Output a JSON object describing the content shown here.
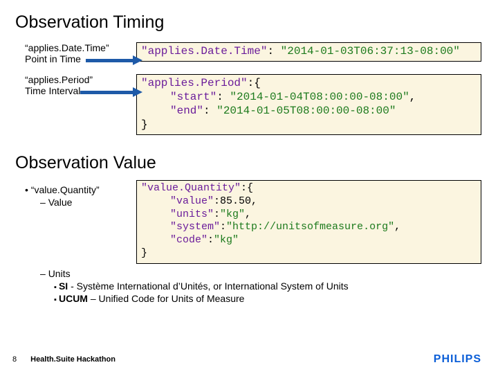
{
  "headings": {
    "timing": "Observation Timing",
    "value": "Observation Value"
  },
  "timing": {
    "datetime": {
      "label1": "“applies.Date.Time”",
      "label2": "Point in Time",
      "code_key": "\"applies.Date.Time\"",
      "code_val": "\"2014-01-03T06:37:13-08:00\""
    },
    "period": {
      "label1": "“applies.Period”",
      "label2": "Time Interval",
      "code_key": "\"applies.Period\"",
      "start_key": "\"start\"",
      "start_val": "\"2014-01-04T08:00:00-08:00\"",
      "end_key": "\"end\"",
      "end_val": "\"2014-01-05T08:00:00-08:00\""
    }
  },
  "value": {
    "bullet_main": "“value.Quantity”",
    "bullet_sub": "Value",
    "code_key": "\"value.Quantity\"",
    "v_key": "\"value\"",
    "v_val": "85.50",
    "u_key": "\"units\"",
    "u_val": "\"kg\"",
    "s_key": "\"system\"",
    "s_val": "\"http://unitsofmeasure.org\"",
    "c_key": "\"code\"",
    "c_val": "\"kg\""
  },
  "units": {
    "heading": "Units",
    "si": "SI - Système International d’Unités, or International System of Units",
    "ucum": "UCUM – Unified Code for Units of Measure"
  },
  "footer": {
    "page": "8",
    "title": "Health.Suite Hackathon",
    "brand": "PHILIPS"
  }
}
